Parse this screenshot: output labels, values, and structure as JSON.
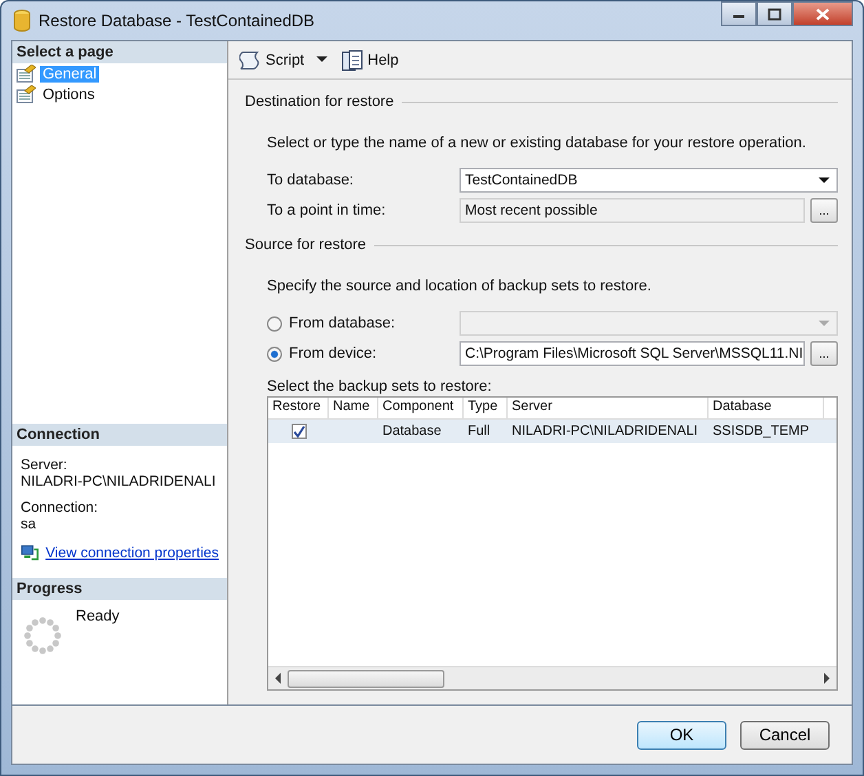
{
  "window": {
    "title": "Restore Database - TestContainedDB"
  },
  "sidebar": {
    "heading": "Select a page",
    "pages": [
      {
        "label": "General",
        "selected": true
      },
      {
        "label": "Options",
        "selected": false
      }
    ]
  },
  "connection": {
    "heading": "Connection",
    "server_label": "Server:",
    "server": "NILADRI-PC\\NILADRIDENALI",
    "connection_label": "Connection:",
    "connection": "sa",
    "link": "View connection properties"
  },
  "progress": {
    "heading": "Progress",
    "status": "Ready"
  },
  "toolbar": [
    {
      "kind": "script",
      "label": "Script"
    },
    {
      "kind": "help",
      "label": "Help"
    }
  ],
  "destination": {
    "heading": "Destination for restore",
    "description": "Select or type the name of a new or existing database for your restore operation.",
    "fields": [
      {
        "kind": "combo",
        "label": "To database:",
        "value": "TestContainedDB",
        "disabled": false
      },
      {
        "kind": "browse",
        "label": "To a point in time:",
        "value": "Most recent possible",
        "disabled": true,
        "button": "..."
      }
    ]
  },
  "source": {
    "heading": "Source for restore",
    "description": "Specify the source and location of backup sets to restore.",
    "options": [
      {
        "kind": "combo",
        "label": "From database:",
        "selected": false
      },
      {
        "kind": "browse",
        "label": "From device:",
        "value": "C:\\Program Files\\Microsoft SQL Server\\MSSQL11.NI",
        "selected": true,
        "button": "..."
      }
    ],
    "sets_label": "Select the backup sets to restore:"
  },
  "table": {
    "columns": [
      "Restore",
      "Name",
      "Component",
      "Type",
      "Server",
      "Database"
    ],
    "rows": [
      {
        "checked": true,
        "selected": true,
        "cells": [
          "",
          "",
          "Database",
          "Full",
          "NILADRI-PC\\NILADRIDENALI",
          "SSISDB_TEMP"
        ]
      }
    ]
  },
  "buttons": [
    {
      "label": "OK",
      "default": true
    },
    {
      "label": "Cancel",
      "default": false
    }
  ]
}
